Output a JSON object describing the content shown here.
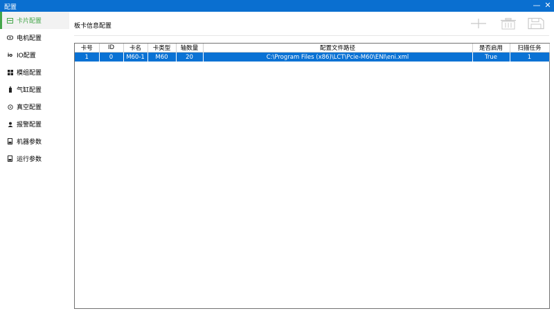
{
  "window": {
    "title": "配置",
    "minimize": "—",
    "close": "✕"
  },
  "sidebar": {
    "items": [
      {
        "label": "卡片配置",
        "icon": "card-icon"
      },
      {
        "label": "电机配置",
        "icon": "motor-icon"
      },
      {
        "label": "IO配置",
        "icon": "io-icon"
      },
      {
        "label": "模组配置",
        "icon": "module-grid-icon"
      },
      {
        "label": "气缸配置",
        "icon": "cylinder-icon"
      },
      {
        "label": "真空配置",
        "icon": "vacuum-icon"
      },
      {
        "label": "报警配置",
        "icon": "alarm-icon"
      },
      {
        "label": "机器参数",
        "icon": "document-icon"
      },
      {
        "label": "运行参数",
        "icon": "document-icon"
      }
    ],
    "active_index": 0
  },
  "main": {
    "title": "板卡信息配置",
    "toolbar": [
      "plus-icon",
      "delete-icon",
      "save-icon"
    ]
  },
  "table": {
    "columns": [
      "卡号",
      "ID",
      "卡名",
      "卡类型",
      "轴数量",
      "配置文件路径",
      "是否启用",
      "扫描任务"
    ],
    "rows": [
      [
        "1",
        "0",
        "M60-1",
        "M60",
        "20",
        "C:\\Program Files (x86)\\LCT\\Pcie-M60\\ENI\\eni.xml",
        "True",
        "1"
      ]
    ]
  },
  "colors": {
    "titlebar": "#0a6fd0",
    "active_nav": "#44a64a",
    "selected_row": "#0a72d4"
  }
}
